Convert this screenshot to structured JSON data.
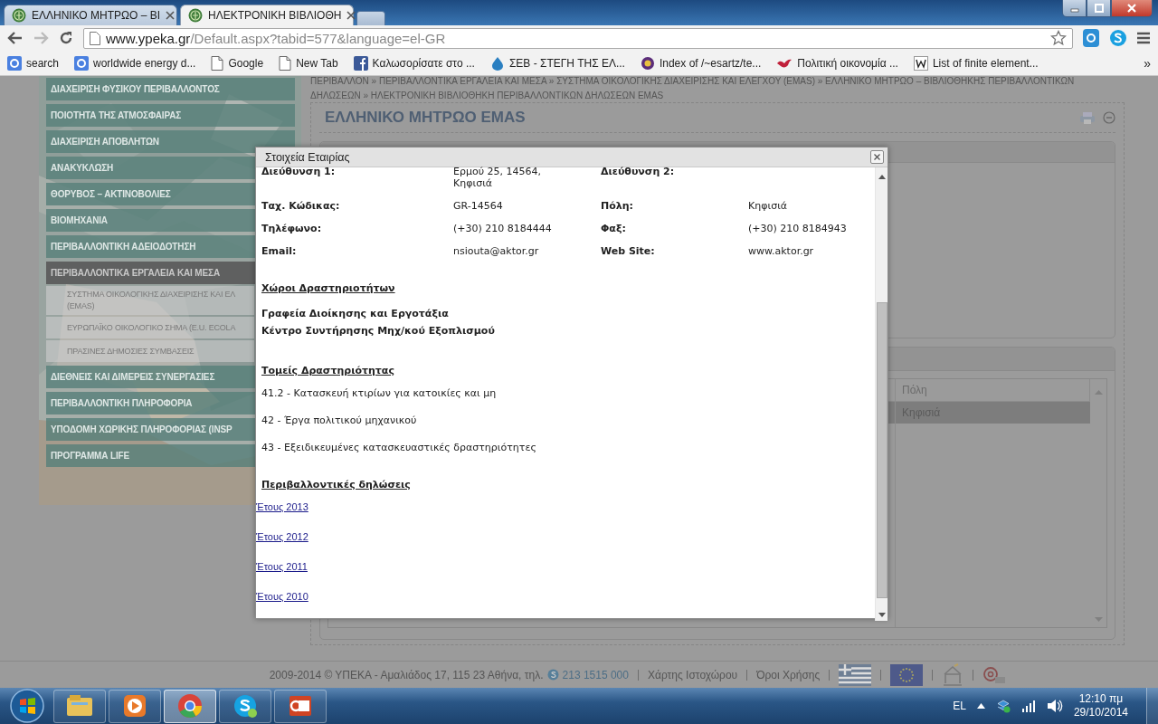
{
  "browser": {
    "tabs": [
      {
        "title": "ΕΛΛΗΝΙΚΟ ΜΗΤΡΩΟ – ΒΙ",
        "selected": false
      },
      {
        "title": "ΗΛΕΚΤΡΟΝΙΚΗ ΒΙΒΛΙΟΘΗ",
        "selected": true
      }
    ],
    "address": {
      "host": "www.ypeka.gr",
      "path": "/Default.aspx?tabid=577&language=el-GR"
    },
    "bookmarks": [
      {
        "label": "search",
        "kind": "g"
      },
      {
        "label": "worldwide energy d...",
        "kind": "g"
      },
      {
        "label": "Google",
        "kind": "page"
      },
      {
        "label": "New Tab",
        "kind": "page"
      },
      {
        "label": "Καλωσορίσατε στο ...",
        "kind": "fb"
      },
      {
        "label": "ΣΕΒ - ΣΤΕΓΗ ΤΗΣ ΕΛ...",
        "kind": "drop"
      },
      {
        "label": "Index of /~esartz/te...",
        "kind": "badge"
      },
      {
        "label": "Πολιτική οικονομία ...",
        "kind": "bird"
      },
      {
        "label": "List of finite element...",
        "kind": "w"
      }
    ],
    "bookmarks_more": "»"
  },
  "sidebar": {
    "items": [
      {
        "label": "ΔΙΑΧΕΙΡΙΣΗ ΦΥΣΙΚΟΥ ΠΕΡΙΒΑΛΛΟΝΤΟΣ",
        "selected": false
      },
      {
        "label": "ΠΟΙΟΤΗΤΑ ΤΗΣ ΑΤΜΟΣΦΑΙΡΑΣ",
        "selected": false
      },
      {
        "label": "ΔΙΑΧΕΙΡΙΣΗ ΑΠΟΒΛΗΤΩΝ",
        "selected": false
      },
      {
        "label": "ΑΝΑΚΥΚΛΩΣΗ",
        "selected": false
      },
      {
        "label": "ΘΟΡΥΒΟΣ – ΑΚΤΙΝΟΒΟΛΙΕΣ",
        "selected": false
      },
      {
        "label": "ΒΙΟΜΗΧΑΝΙΑ",
        "selected": false
      },
      {
        "label": "ΠΕΡΙΒΑΛΛΟΝΤΙΚΗ ΑΔΕΙΟΔΟΤΗΣΗ",
        "selected": false
      },
      {
        "label": "ΠΕΡΙΒΑΛΛΟΝΤΙΚΑ ΕΡΓΑΛΕΙΑ ΚΑΙ ΜΕΣΑ",
        "selected": true,
        "children": [
          {
            "label": "ΣΥΣΤΗΜΑ ΟΙΚΟΛΟΓΙΚΗΣ ΔΙΑΧΕΙΡΙΣΗΣ ΚΑΙ ΕΛ (EMAS)",
            "selected": false
          },
          {
            "label": "ΕΥΡΩΠΑΪΚΟ ΟΙΚΟΛΟΓΙΚΟ ΣΗΜΑ (E.U. ECOLA",
            "selected": false
          },
          {
            "label": "ΠΡΑΣΙΝΕΣ ΔΗΜΟΣΙΕΣ ΣΥΜΒΑΣΕΙΣ",
            "selected": false
          }
        ]
      },
      {
        "label": "ΔΙΕΘΝΕΙΣ ΚΑΙ ΔΙΜΕΡΕΙΣ ΣΥΝΕΡΓΑΣΙΕΣ",
        "selected": false
      },
      {
        "label": "ΠΕΡΙΒΑΛΛΟΝΤΙΚΗ ΠΛΗΡΟΦΟΡΙΑ",
        "selected": false
      },
      {
        "label": "ΥΠΟΔΟΜΗ ΧΩΡΙΚΗΣ ΠΛΗΡΟΦΟΡΙΑΣ (INSP",
        "selected": false
      },
      {
        "label": "ΠΡΟΓΡΑΜΜΑ LIFE",
        "selected": false
      }
    ]
  },
  "breadcrumb": "ΠΕΡΙΒΑΛΛΟΝ » ΠΕΡΙΒΑΛΛΟΝΤΙΚΑ ΕΡΓΑΛΕΙΑ ΚΑΙ ΜΕΣΑ » ΣΥΣΤΗΜΑ ΟΙΚΟΛΟΓΙΚΗΣ ΔΙΑΧΕΙΡΙΣΗΣ ΚΑΙ ΕΛΕΓΧΟΥ (EMAS) » ΕΛΛΗΝΙΚΟ ΜΗΤΡΩΟ – ΒΙΒΛΙΟΘΗΚΗΣ ΠΕΡΙΒΑΛΛΟΝΤΙΚΩΝ ΔΗΛΩΣΕΩΝ » ΗΛΕΚΤΡΟΝΙΚΗ ΒΙΒΛΙΟΘΗΚΗ ΠΕΡΙΒΑΛΛΟΝΤΙΚΩΝ ΔΗΛΩΣΕΩΝ EMAS",
  "panel": {
    "title": "ΕΛΛΗΝΙΚΟ ΜΗΤΡΩΟ EMAS"
  },
  "table": {
    "columns": [
      "Πόλη"
    ],
    "rows": [
      {
        "cells": [
          "Κηφισιά"
        ],
        "selected": true
      }
    ]
  },
  "dialog": {
    "title": "Στοιχεία Εταιρίας",
    "fields": [
      {
        "label": "Διεύθυνση 1:",
        "value": "Ερμού 25, 14564, Κηφισιά"
      },
      {
        "label": "Διεύθυνση 2:"
      },
      {
        "label": "Ταχ. Κώδικας:",
        "value": "GR-14564"
      },
      {
        "label": "Πόλη:",
        "value": "Κηφισιά"
      },
      {
        "label": "Τηλέφωνο:",
        "value": "(+30) 210 8184444"
      },
      {
        "label": "Φαξ:",
        "value": "(+30) 210 8184943"
      },
      {
        "label": "Email:",
        "value": "nsiouta@aktor.gr"
      },
      {
        "label": "Web Site:",
        "value": "www.aktor.gr"
      }
    ],
    "sections": [
      {
        "heading": "Χώροι Δραστηριοτήτων",
        "kind": "bold",
        "items": [
          "Γραφεία Διοίκησης και Εργοτάξια",
          "Κέντρο Συντήρησης Μηχ/κού Εξοπλισμού"
        ]
      },
      {
        "heading": "Τομείς Δραστηριότητας",
        "kind": "plain",
        "items": [
          "41.2 - Κατασκευή κτιρίων για κατοικίες και μη",
          "42 - Έργα πολιτικού μηχανικού",
          "43 - Εξειδικευμένες κατασκευαστικές δραστηριότητες"
        ]
      },
      {
        "heading": "Περιβαλλοντικές δηλώσεις",
        "kind": "links",
        "items": [
          "Έτους 2013",
          "Έτους 2012",
          "Έτους 2011",
          "Έτους 2010"
        ]
      }
    ]
  },
  "footer": {
    "copyright": "2009-2014 © ΥΠΕΚΑ - Αμαλιάδος 17, 115 23 Αθήνα, τηλ.",
    "phone": "213 1515 000",
    "links": [
      "Χάρτης Ιστοχώρου",
      "Όροι Χρήσης"
    ]
  },
  "taskbar": {
    "apps": [
      {
        "kind": "folder",
        "selected": false
      },
      {
        "kind": "player",
        "selected": false
      },
      {
        "kind": "chrome",
        "selected": true
      },
      {
        "kind": "skype",
        "selected": false
      },
      {
        "kind": "slides",
        "selected": false
      }
    ],
    "language": "EL",
    "time": "12:10 πμ",
    "date": "29/10/2014"
  }
}
